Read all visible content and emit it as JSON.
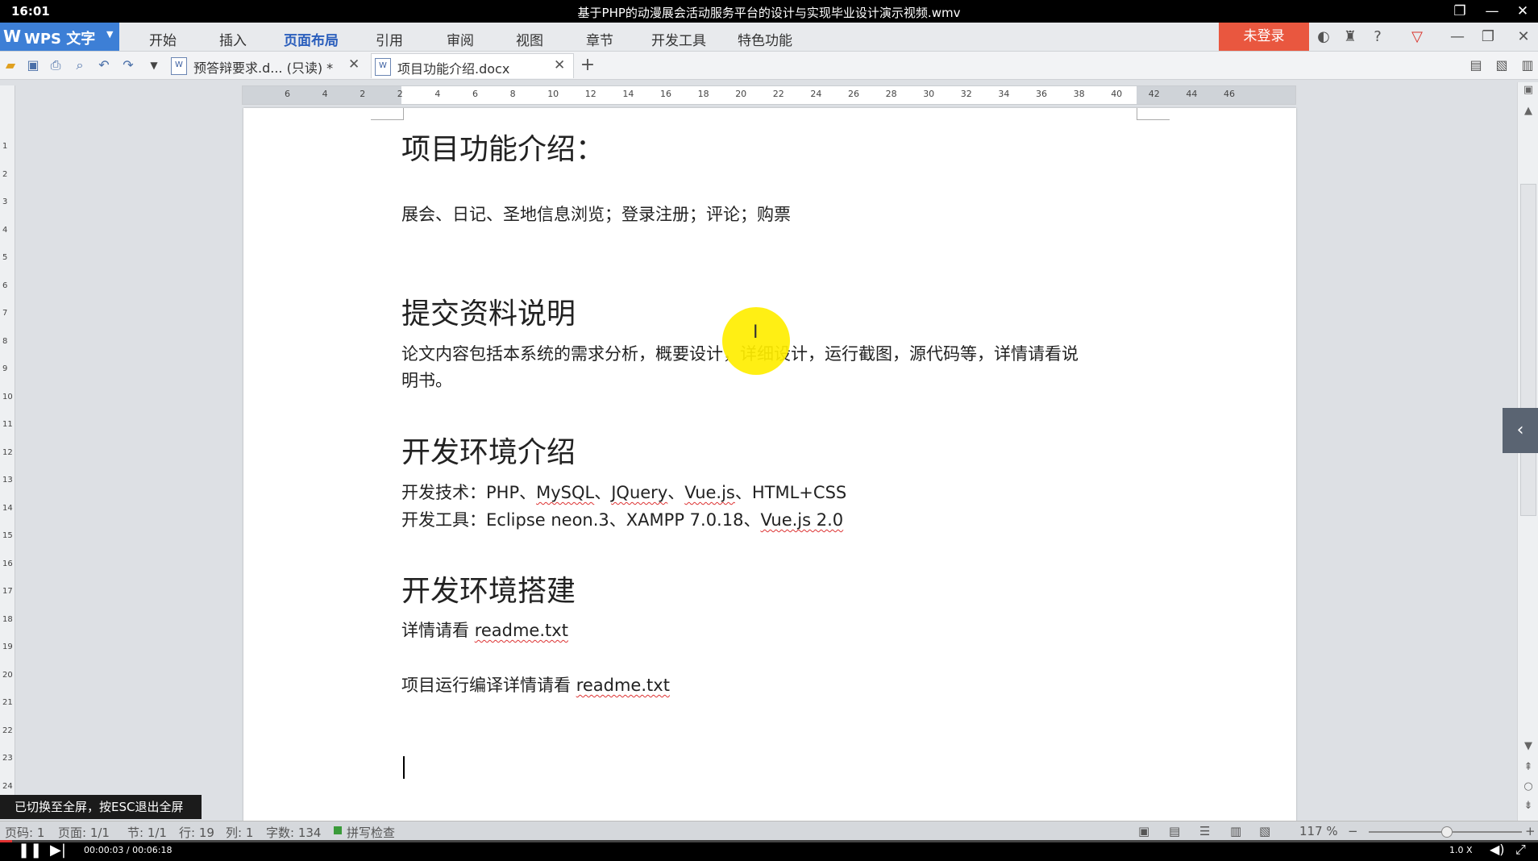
{
  "window": {
    "time": "16:01",
    "title": "基于PHP的动漫展会活动服务平台的设计与实现毕业设计演示视频.wmv"
  },
  "menubar": {
    "app_label": "WPS 文字",
    "items": [
      "开始",
      "插入",
      "页面布局",
      "引用",
      "审阅",
      "视图",
      "章节",
      "开发工具",
      "特色功能"
    ],
    "active": "页面布局",
    "login_label": "未登录"
  },
  "tabs": [
    {
      "label": "预答辩要求.d... (只读) *"
    },
    {
      "label": "项目功能介绍.docx"
    }
  ],
  "ruler": {
    "h_ticks": [
      "6",
      "4",
      "2",
      "2",
      "4",
      "6",
      "8",
      "10",
      "12",
      "14",
      "16",
      "18",
      "20",
      "22",
      "24",
      "26",
      "28",
      "30",
      "32",
      "34",
      "36",
      "38",
      "40",
      "42",
      "44",
      "46"
    ],
    "v_ticks": [
      "1",
      "2",
      "3",
      "4",
      "5",
      "6",
      "7",
      "8",
      "9",
      "10",
      "11",
      "12",
      "13",
      "14",
      "15",
      "16",
      "17",
      "18",
      "19",
      "20",
      "21",
      "22",
      "23",
      "24"
    ]
  },
  "document": {
    "heading1": "项目功能介绍：",
    "features": "展会、日记、圣地信息浏览；登录注册；评论；购票",
    "heading2": "提交资料说明",
    "submit_line1": "论文内容包括本系统的需求分析，概要设计，详细设计，运行截图，源代码等，详情请看说",
    "submit_line2": "明书。",
    "heading3": "开发环境介绍",
    "tech_label": "开发技术：",
    "tech_items": [
      "PHP",
      "MySQL",
      "JQuery",
      "Vue.js",
      "HTML+CSS"
    ],
    "tools_label": "开发工具：",
    "tools_items": [
      "Eclipse neon.3",
      "XAMPP 7.0.18",
      "Vue.js 2.0"
    ],
    "sep": "、",
    "heading4": "开发环境搭建",
    "setup_prefix": "详情请看 ",
    "setup_file": "readme.txt",
    "run_prefix": "项目运行编译详情请看 ",
    "run_file": "readme.txt"
  },
  "notice": "已切换至全屏，按ESC退出全屏",
  "statusbar": {
    "page_num": "页码: 1",
    "page": "页面: 1/1",
    "section": "节: 1/1",
    "row": "行: 19",
    "col": "列: 1",
    "words": "字数: 134",
    "spell": "拼写检查",
    "zoom": "117 %"
  },
  "player": {
    "time": "00:00:03 / 00:06:18",
    "speed": "1.0 X",
    "progress": 0.008
  },
  "icons": [
    "restore-icon",
    "minimize-icon",
    "close-icon",
    "open-icon",
    "save-icon",
    "print-icon",
    "preview-icon",
    "undo-icon",
    "redo-icon",
    "dropdown-icon",
    "add-tab-icon",
    "skin-icon",
    "shirt-icon",
    "help-icon",
    "collapse-ribbon-icon",
    "pause-icon",
    "next-icon",
    "volume-icon",
    "fullscreen-icon"
  ]
}
